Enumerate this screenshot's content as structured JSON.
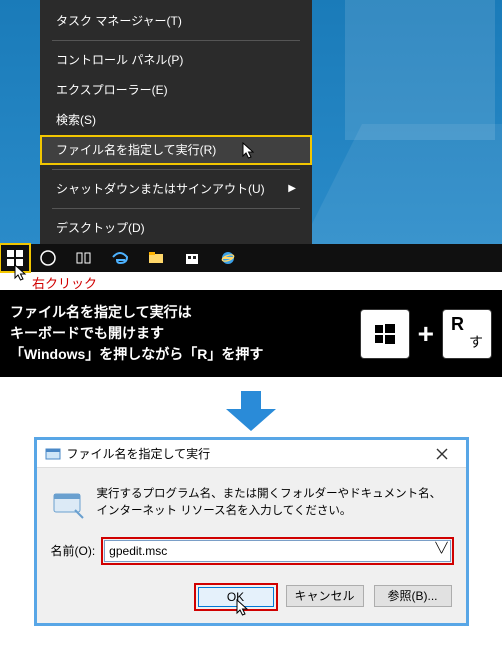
{
  "panel1": {
    "menu": {
      "items": [
        {
          "label": "タスク マネージャー(T)",
          "arrow": false
        },
        {
          "label": "コントロール パネル(P)",
          "arrow": false
        },
        {
          "label": "エクスプローラー(E)",
          "arrow": false
        },
        {
          "label": "検索(S)",
          "arrow": false
        },
        {
          "label": "ファイル名を指定して実行(R)",
          "arrow": false,
          "highlight": true
        },
        {
          "label": "シャットダウンまたはサインアウト(U)",
          "arrow": true
        },
        {
          "label": "デスクトップ(D)",
          "arrow": false
        }
      ]
    },
    "right_click_label": "右クリック"
  },
  "panel2": {
    "line1": "ファイル名を指定して実行は",
    "line2": "キーボードでも開けます",
    "line3": "「Windows」を押しながら「R」を押す",
    "plus": "+",
    "r_key": "R",
    "r_sub": "す"
  },
  "dialog": {
    "title": "ファイル名を指定して実行",
    "body_text": "実行するプログラム名、または開くフォルダーやドキュメント名、インターネット リソース名を入力してください。",
    "name_label": "名前(O):",
    "input_value": "gpedit.msc",
    "ok": "OK",
    "cancel": "キャンセル",
    "browse": "参照(B)..."
  }
}
